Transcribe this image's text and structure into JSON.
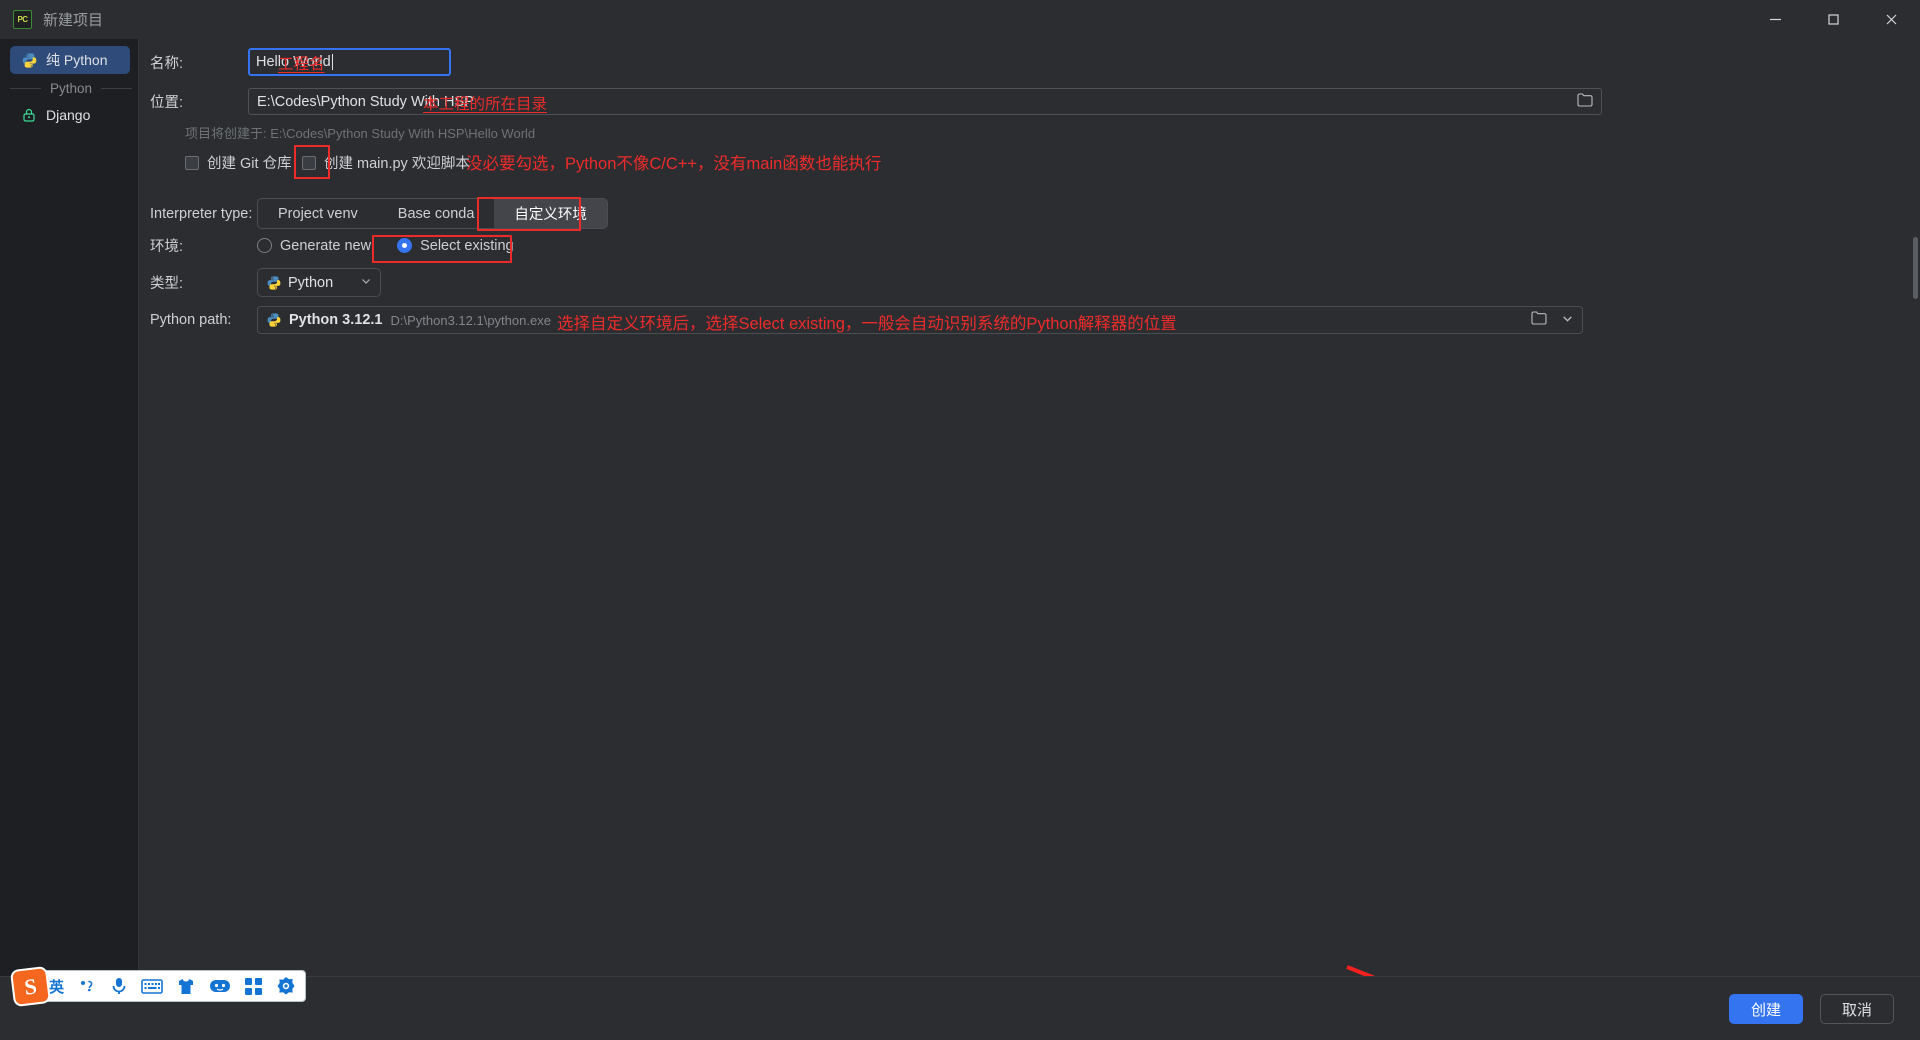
{
  "window": {
    "title": "新建项目",
    "app_icon": "pycharm-icon",
    "minimize": "−",
    "maximize": "□",
    "close": "✕"
  },
  "sidebar": {
    "items": [
      {
        "label": "纯 Python",
        "icon": "python-icon",
        "active": true
      },
      {
        "label": "Django",
        "icon": "lock-icon",
        "active": false
      }
    ],
    "group_label": "Python"
  },
  "form": {
    "name": {
      "label": "名称:",
      "value": "Hello World"
    },
    "location": {
      "label": "位置:",
      "value": "E:\\Codes\\Python Study With HSP",
      "browse_icon": "folder-icon"
    },
    "hint": "项目将创建于: E:\\Codes\\Python Study With HSP\\Hello World",
    "checkboxes": [
      {
        "label": "创建 Git 仓库",
        "checked": false
      },
      {
        "label": "创建 main.py 欢迎脚本",
        "checked": false
      }
    ],
    "interpreter_type": {
      "label": "Interpreter type:",
      "options": [
        "Project venv",
        "Base conda",
        "自定义环境"
      ],
      "selected": "自定义环境"
    },
    "environment": {
      "label": "环境:",
      "options": [
        "Generate new",
        "Select existing"
      ],
      "selected": "Select existing"
    },
    "type": {
      "label": "类型:",
      "value": "Python",
      "icon": "python-icon",
      "chevron": "chevron-down-icon"
    },
    "python_path": {
      "label": "Python path:",
      "name": "Python 3.12.1",
      "path": "D:\\Python3.12.1\\python.exe",
      "icon": "python-icon",
      "browse_icon": "folder-icon",
      "chevron": "chevron-down-icon"
    }
  },
  "annotations": [
    {
      "id": "name-annotation",
      "text": "工程名"
    },
    {
      "id": "location-annotation",
      "text": "本工程的所在目录"
    },
    {
      "id": "mainpy-annotation",
      "text": "没必要勾选，Python不像C/C++，没有main函数也能执行"
    },
    {
      "id": "pythonpath-annotation",
      "text": "选择自定义环境后，选择Select existing，一般会自动识别系统的Python解释器的位置"
    }
  ],
  "footer": {
    "create_label": "创建",
    "cancel_label": "取消"
  },
  "ime": {
    "logo": "S",
    "mode": "英",
    "items": [
      "punctuation-icon",
      "microphone-icon",
      "keyboard-icon",
      "skin-icon",
      "emoji-icon",
      "apps-icon",
      "settings-icon"
    ]
  },
  "colors": {
    "accent": "#3574f0",
    "annotation": "#ee2b2b",
    "sidebar_bg": "#1e1f22",
    "main_bg": "#2b2d30"
  }
}
